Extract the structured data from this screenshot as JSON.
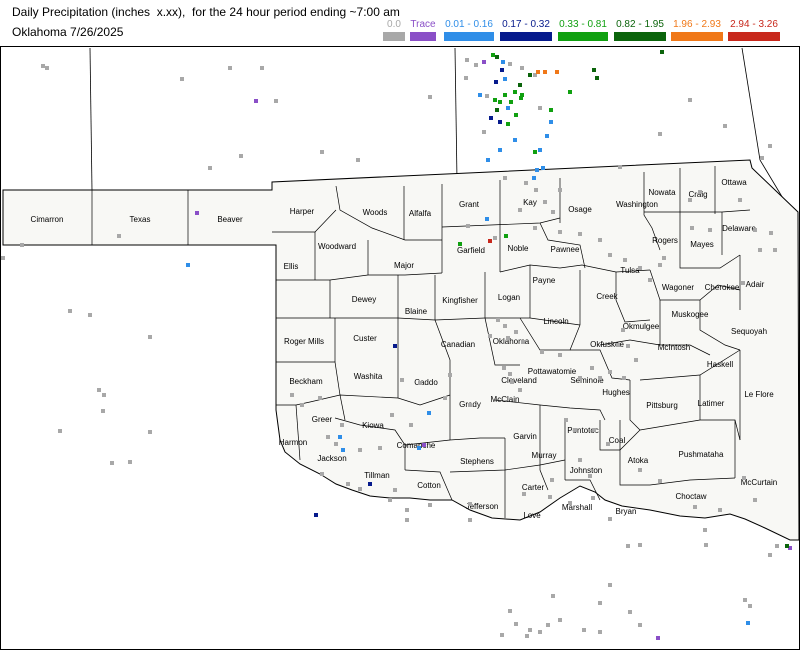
{
  "header": {
    "title": "Daily Precipitation (inches  x.xx),  for the 24 hour period ending ~7:00 am",
    "subtitle": "Oklahoma 7/26/2025"
  },
  "legend": [
    {
      "label": "0.0",
      "color": "#a8a8a8"
    },
    {
      "label": "Trace",
      "color": "#8a4fc7"
    },
    {
      "label": "0.01 - 0.16",
      "color": "#2f8ee8"
    },
    {
      "label": "0.17 - 0.32",
      "color": "#061a8c"
    },
    {
      "label": "0.33 - 0.81",
      "color": "#10a010"
    },
    {
      "label": "0.82 - 1.95",
      "color": "#0b640b"
    },
    {
      "label": "1.96 - 2.93",
      "color": "#f07818"
    },
    {
      "label": "2.94 - 3.26",
      "color": "#c8281c"
    }
  ],
  "map": {
    "background": "#ffffff",
    "state_fill": "#f8f8f5",
    "line_color": "#000000",
    "counties": [
      "Cimarron",
      "Texas",
      "Beaver",
      "Harper",
      "Woods",
      "Alfalfa",
      "Grant",
      "Kay",
      "Osage",
      "Washington",
      "Nowata",
      "Craig",
      "Ottawa",
      "Woodward",
      "Major",
      "Garfield",
      "Noble",
      "Pawnee",
      "Rogers",
      "Mayes",
      "Delaware",
      "Ellis",
      "Tulsa",
      "Payne",
      "Wagoner",
      "Cherokee",
      "Adair",
      "Dewey",
      "Blaine",
      "Kingfisher",
      "Logan",
      "Creek",
      "Lincoln",
      "Okmulgee",
      "Muskogee",
      "Sequoyah",
      "Roger Mills",
      "Custer",
      "Canadian",
      "Oklahoma",
      "Okfuskee",
      "McIntosh",
      "Haskell",
      "Beckham",
      "Washita",
      "Caddo",
      "Pottawatomie",
      "Seminole",
      "Cleveland",
      "McClain",
      "Hughes",
      "Pittsburg",
      "Latimer",
      "Le Flore",
      "Greer",
      "Harmon",
      "Kiowa",
      "Grady",
      "Garvin",
      "Pontotoc",
      "Coal",
      "Jackson",
      "Comanche",
      "Stephens",
      "Murray",
      "Atoka",
      "Pushmataha",
      "Tillman",
      "Cotton",
      "Johnston",
      "Carter",
      "McCurtain",
      "Choctaw",
      "Jefferson",
      "Love",
      "Marshall",
      "Bryan"
    ],
    "stations": [
      {
        "cat": 0,
        "n": 155
      },
      {
        "cat": 1,
        "n": 8
      },
      {
        "cat": 2,
        "n": 22
      },
      {
        "cat": 3,
        "n": 8
      },
      {
        "cat": 4,
        "n": 15
      },
      {
        "cat": 5,
        "n": 11
      },
      {
        "cat": 6,
        "n": 3
      },
      {
        "cat": 7,
        "n": 1
      }
    ]
  }
}
